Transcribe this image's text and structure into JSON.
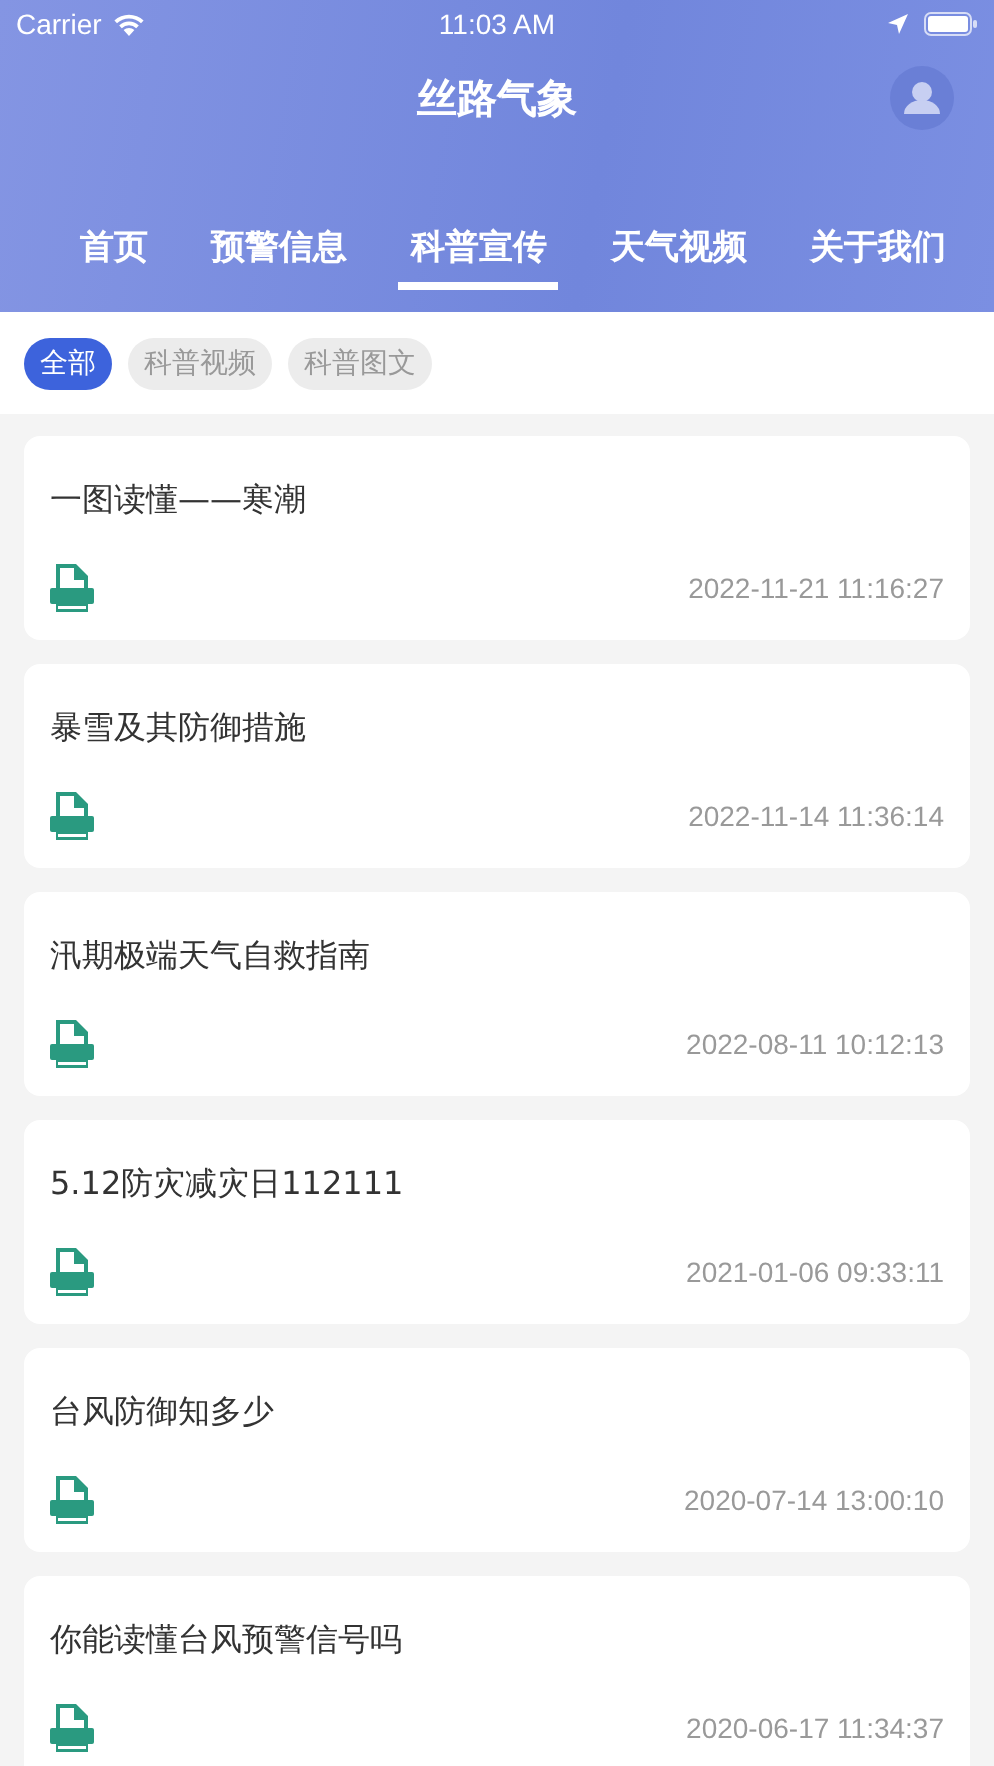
{
  "status_bar": {
    "carrier": "Carrier",
    "time": "11:03 AM"
  },
  "header": {
    "title": "丝路气象"
  },
  "tabs": [
    {
      "label": "首页",
      "selected": false
    },
    {
      "label": "预警信息",
      "selected": false
    },
    {
      "label": "科普宣传",
      "selected": true
    },
    {
      "label": "天气视频",
      "selected": false
    },
    {
      "label": "关于我们",
      "selected": false
    }
  ],
  "filters": [
    {
      "label": "全部",
      "selected": true
    },
    {
      "label": "科普视频",
      "selected": false
    },
    {
      "label": "科普图文",
      "selected": false
    }
  ],
  "articles": [
    {
      "title": "一图读懂——寒潮",
      "time": "2022-11-21 11:16:27"
    },
    {
      "title": "暴雪及其防御措施",
      "time": "2022-11-14 11:36:14"
    },
    {
      "title": "汛期极端天气自救指南",
      "time": "2022-08-11 10:12:13"
    },
    {
      "title": "5.12防灾减灾日112111",
      "time": "2021-01-06 09:33:11"
    },
    {
      "title": "台风防御知多少",
      "time": "2020-07-14 13:00:10"
    },
    {
      "title": "你能读懂台风预警信号吗",
      "time": "2020-06-17 11:34:37"
    }
  ]
}
